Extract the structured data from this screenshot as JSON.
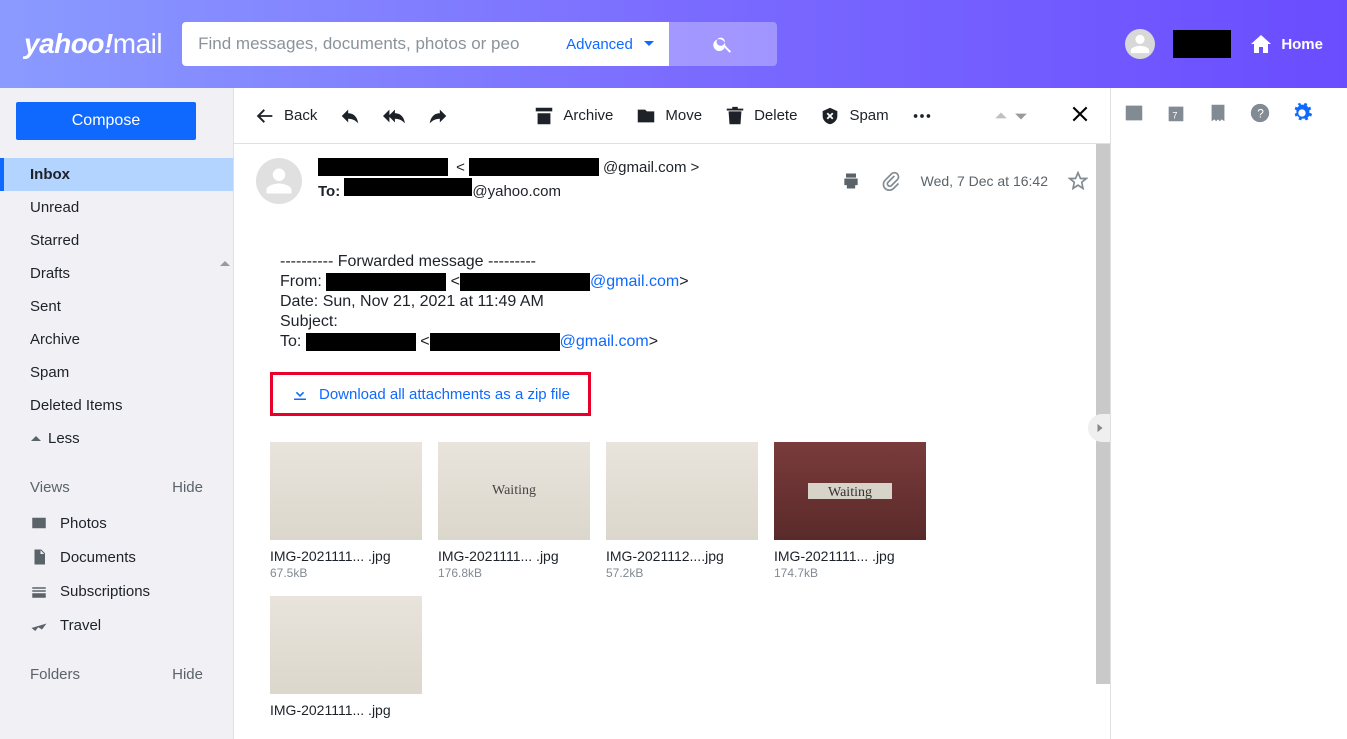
{
  "header": {
    "logo_main": "yahoo!",
    "logo_sub": "mail",
    "search_placeholder": "Find messages, documents, photos or peo",
    "advanced_label": "Advanced",
    "home_label": "Home"
  },
  "sidebar": {
    "compose_label": "Compose",
    "folders": [
      "Inbox",
      "Unread",
      "Starred",
      "Drafts",
      "Sent",
      "Archive",
      "Spam",
      "Deleted Items"
    ],
    "less_label": "Less",
    "views_label": "Views",
    "hide_label": "Hide",
    "view_items": [
      "Photos",
      "Documents",
      "Subscriptions",
      "Travel"
    ],
    "folders_label": "Folders"
  },
  "toolbar": {
    "back": "Back",
    "archive": "Archive",
    "move": "Move",
    "delete": "Delete",
    "spam": "Spam"
  },
  "message": {
    "from_domain": "@gmail.com",
    "to_label": "To:",
    "to_domain": "@yahoo.com",
    "timestamp": "Wed, 7 Dec at 16:42",
    "fwd_header": "---------- Forwarded message ---------",
    "from_label": "From:",
    "fwd_from_domain": "@gmail.com",
    "date_line": "Date: Sun, Nov 21, 2021 at 11:49 AM",
    "subject_line": "Subject:",
    "fwd_to_label": "To:",
    "fwd_to_domain": "@gmail.com",
    "download_label": "Download all attachments as a zip file",
    "attachments": [
      {
        "name": "IMG-2021111... .jpg",
        "size": "67.5kB"
      },
      {
        "name": "IMG-2021111... .jpg",
        "size": "176.8kB"
      },
      {
        "name": "IMG-2021112....jpg",
        "size": "57.2kB"
      },
      {
        "name": "IMG-2021111... .jpg",
        "size": "174.7kB"
      },
      {
        "name": "IMG-2021111... .jpg",
        "size": ""
      }
    ]
  }
}
